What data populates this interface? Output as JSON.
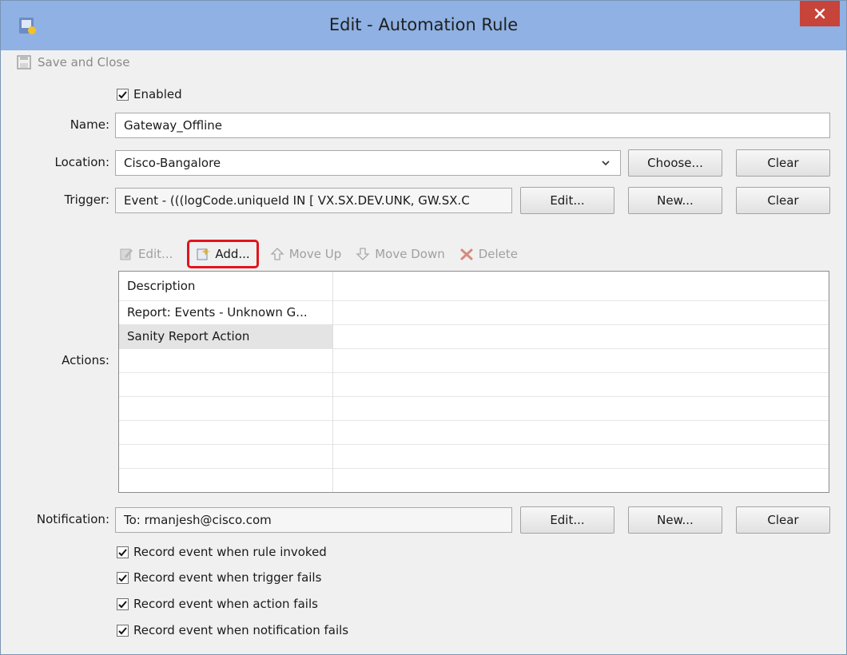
{
  "window": {
    "title": "Edit - Automation Rule"
  },
  "toolbar": {
    "save_close": "Save and Close"
  },
  "form": {
    "enabled_label": "Enabled",
    "name_label": "Name:",
    "name_value": "Gateway_Offline",
    "location_label": "Location:",
    "location_value": "Cisco-Bangalore",
    "trigger_label": "Trigger:",
    "trigger_value": "Event - (((logCode.uniqueId IN [ VX.SX.DEV.UNK, GW.SX.C",
    "choose_label": "Choose...",
    "clear_label": "Clear",
    "edit_label": "Edit...",
    "new_label": "New..."
  },
  "actions": {
    "label": "Actions:",
    "toolbar": {
      "edit": "Edit...",
      "add": "Add...",
      "move_up": "Move Up",
      "move_down": "Move Down",
      "delete": "Delete"
    },
    "column_header": "Description",
    "rows": [
      "Report: Events - Unknown G...",
      "Sanity Report Action"
    ]
  },
  "notification": {
    "label": "Notification:",
    "value": "To: rmanjesh@cisco.com"
  },
  "options": {
    "rule_invoked": "Record event when rule invoked",
    "trigger_fails": "Record event when trigger fails",
    "action_fails": "Record event when action fails",
    "notification_fails": "Record event when notification fails"
  },
  "colors": {
    "title_bar": "#8fb1e3",
    "close_button": "#c7443a",
    "highlight": "#e1151b"
  }
}
